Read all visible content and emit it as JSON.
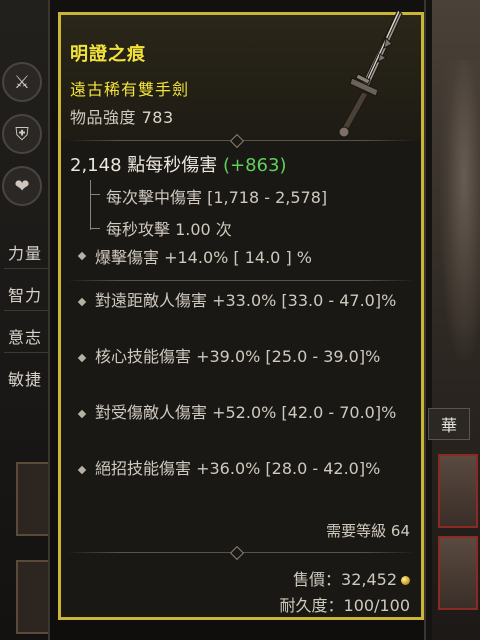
{
  "background": {
    "side_buttons": [
      {
        "icon": "crossed-swords-icon",
        "glyph": "⚔"
      },
      {
        "icon": "shield-icon",
        "glyph": "⛨"
      },
      {
        "icon": "heart-icon",
        "glyph": "❤"
      }
    ],
    "stats": [
      "力量",
      "智力",
      "意志",
      "敏捷"
    ],
    "right_tab": "華"
  },
  "item": {
    "name": "明證之痕",
    "type": "遠古稀有雙手劍",
    "power_label": "物品強度",
    "power_value": "783",
    "dps_value": "2,148",
    "dps_label": "點每秒傷害",
    "dps_bonus": "(+863)",
    "damage_per_hit": "每次擊中傷害 [1,718 - 2,578]",
    "attacks_per_second": "每秒攻擊 1.00 次",
    "implicit": "爆擊傷害 +14.0%  [ 14.0 ] %",
    "affixes": [
      "對遠距敵人傷害 +33.0% [33.0 - 47.0]%",
      "核心技能傷害 +39.0% [25.0 - 39.0]%",
      "對受傷敵人傷害 +52.0% [42.0 - 70.0]%",
      "絕招技能傷害 +36.0% [28.0 - 42.0]%"
    ],
    "required_level": "需要等級 64",
    "sell_label": "售價：",
    "sell_value": "32,452",
    "durability_label": "耐久度：",
    "durability_value": "100/100"
  },
  "colors": {
    "frame": "#c9b735",
    "name": "#f2e23a",
    "bonus": "#5fd15a",
    "text": "#cfc8bd"
  }
}
